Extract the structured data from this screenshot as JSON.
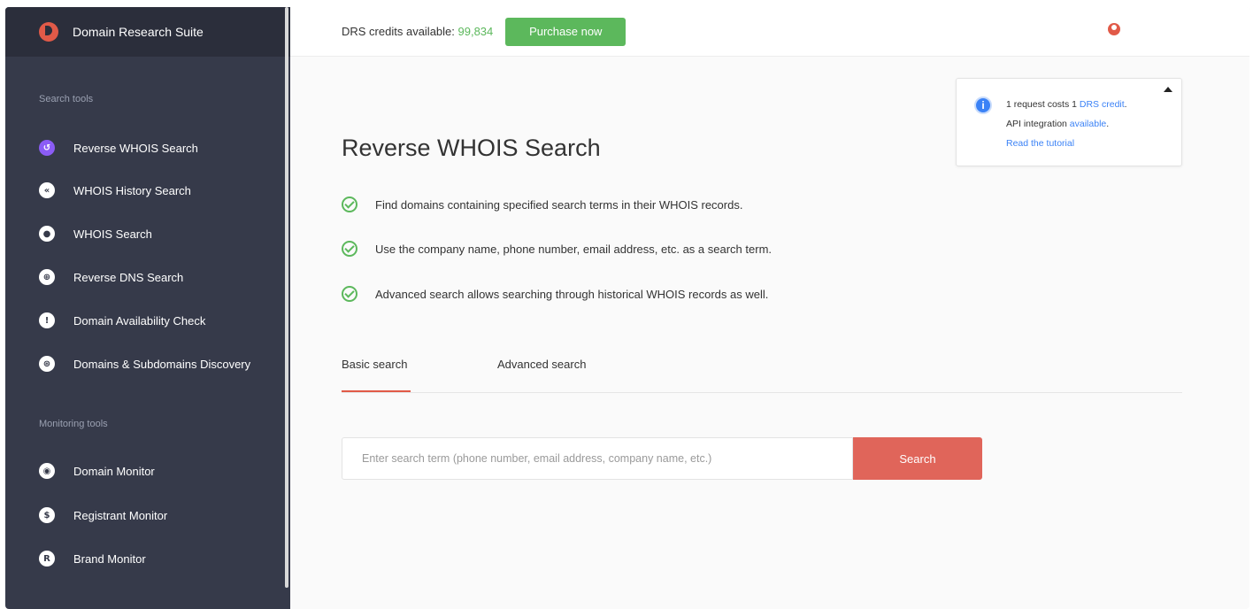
{
  "app": {
    "title": "Domain Research Suite"
  },
  "sidebar": {
    "search_section_label": "Search tools",
    "search_items": [
      {
        "label": "Reverse WHOIS Search",
        "icon": "reverse-whois-icon",
        "active": true
      },
      {
        "label": "WHOIS History Search",
        "icon": "history-icon"
      },
      {
        "label": "WHOIS Search",
        "icon": "user-circle-icon"
      },
      {
        "label": "Reverse DNS Search",
        "icon": "globe-icon"
      },
      {
        "label": "Domain Availability Check",
        "icon": "exclamation-icon"
      },
      {
        "label": "Domains & Subdomains Discovery",
        "icon": "discovery-icon"
      }
    ],
    "monitoring_section_label": "Monitoring tools",
    "monitoring_items": [
      {
        "label": "Domain Monitor",
        "icon": "domain-monitor-icon"
      },
      {
        "label": "Registrant Monitor",
        "icon": "registrant-icon"
      },
      {
        "label": "Brand Monitor",
        "icon": "registered-icon"
      }
    ]
  },
  "topbar": {
    "credits_label": "DRS credits available: ",
    "credits_value": "99,834",
    "purchase_label": "Purchase now"
  },
  "info": {
    "line1_prefix": "1 request costs 1 ",
    "line1_link": "DRS credit",
    "line1_suffix": ".",
    "line2_prefix": "API integration ",
    "line2_link": "available",
    "line2_suffix": ".",
    "tutorial_link": "Read the tutorial"
  },
  "main": {
    "title": "Reverse WHOIS Search",
    "features": [
      "Find domains containing specified search terms in their WHOIS records.",
      "Use the company name, phone number, email address, etc. as a search term.",
      "Advanced search allows searching through historical WHOIS records as well."
    ],
    "tabs": [
      {
        "label": "Basic search",
        "active": true
      },
      {
        "label": "Advanced search"
      }
    ],
    "search_placeholder": "Enter search term (phone number, email address, company name, etc.)",
    "search_button": "Search"
  },
  "colors": {
    "sidebar_bg": "#363a4a",
    "accent_red": "#e15a48",
    "accent_green": "#5cb85c",
    "link_blue": "#3b82f6",
    "active_purple": "#8b5cf6"
  }
}
